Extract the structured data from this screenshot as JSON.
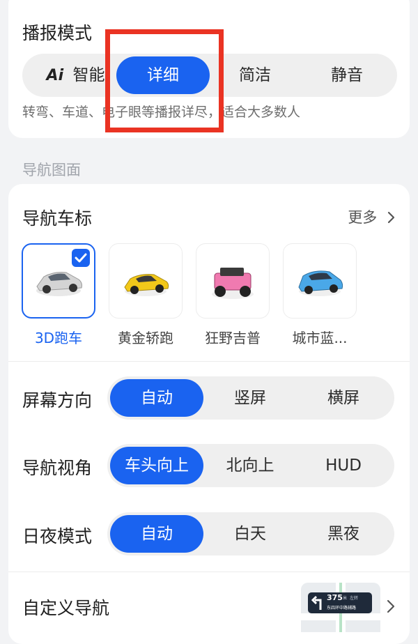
{
  "broadcast": {
    "title": "播报模式",
    "ai_logo": "Ai",
    "options": [
      "智能",
      "详细",
      "简洁",
      "静音"
    ],
    "selected": "详细",
    "description": "转弯、车道、电子眼等播报详尽，适合大多数人"
  },
  "nav_screen": {
    "group_label": "导航图面"
  },
  "car_icon": {
    "title": "导航车标",
    "more_label": "更多",
    "items": [
      {
        "name": "3D跑车",
        "color": "#d9d9d9",
        "selected": true
      },
      {
        "name": "黄金轿跑",
        "color": "#f2c81a",
        "selected": false
      },
      {
        "name": "狂野吉普",
        "color": "#f07ab0",
        "selected": false
      },
      {
        "name": "城市蓝...",
        "color": "#4aa8e8",
        "selected": false
      }
    ]
  },
  "screen_orientation": {
    "title": "屏幕方向",
    "options": [
      "自动",
      "竖屏",
      "横屏"
    ],
    "selected": "自动"
  },
  "nav_view": {
    "title": "导航视角",
    "options": [
      "车头向上",
      "北向上",
      "HUD"
    ],
    "selected": "车头向上"
  },
  "day_night": {
    "title": "日夜模式",
    "options": [
      "自动",
      "白天",
      "黑夜"
    ],
    "selected": "自动"
  },
  "custom_nav": {
    "title": "自定义导航",
    "preview_distance": "375",
    "preview_unit": "米",
    "preview_direction": "左转",
    "preview_road": "东四环中路辅路"
  },
  "colors": {
    "accent": "#1a63f0",
    "highlight_box": "#ea3323"
  }
}
